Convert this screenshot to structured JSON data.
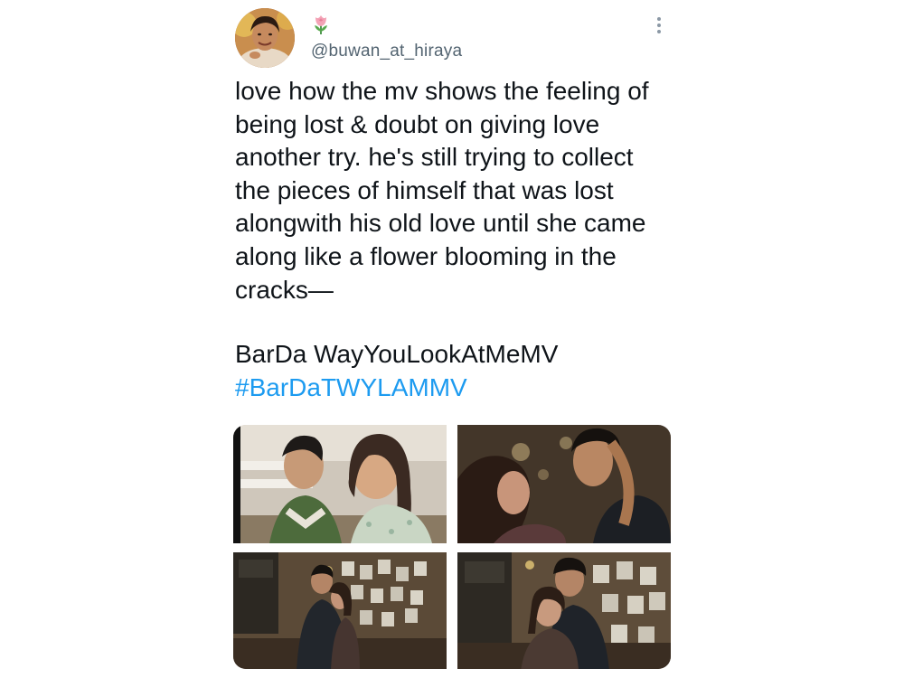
{
  "tweet": {
    "handle": "@buwan_at_hiraya",
    "text": "love how the mv shows the feeling of\nbeing lost & doubt on giving love\nanother try. he's still trying to collect\nthe pieces of himself that was lost\nalongwith his old love until she came\nalong like a flower blooming in the\ncracks—",
    "tag_line": "BarDa WayYouLookAtMeMV",
    "hashtag": "#BarDaTWYLAMMV"
  },
  "icons": {
    "display_name": "tulip-icon",
    "menu": "more-options-icon"
  },
  "colors": {
    "text": "#0f1419",
    "secondary": "#536471",
    "link": "#1d9bf0"
  }
}
